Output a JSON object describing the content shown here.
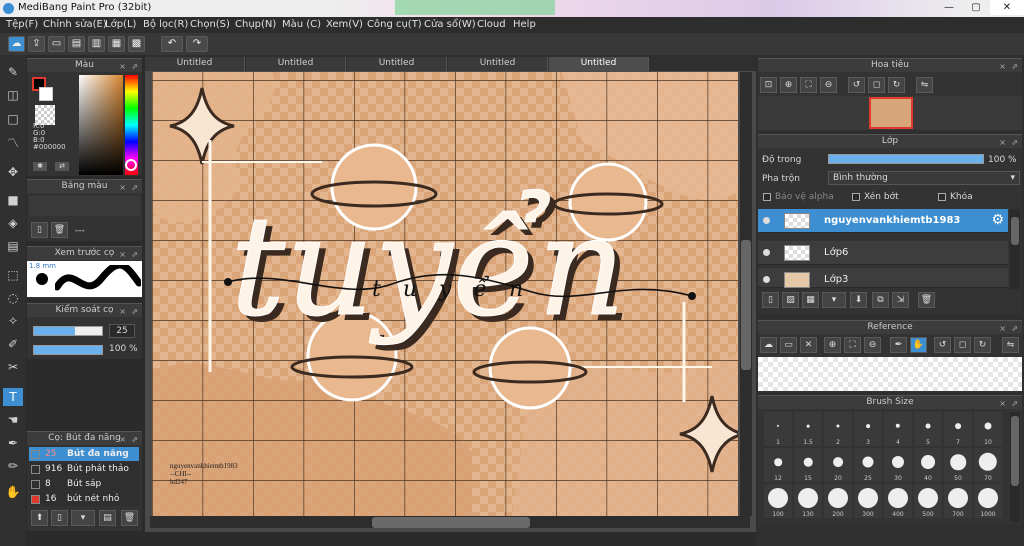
{
  "window": {
    "title": "MediBang Paint Pro (32bit)",
    "controls": [
      "—",
      "▢",
      "✕"
    ]
  },
  "menu": [
    "Tệp(F)",
    "Chỉnh sửa(E)",
    "Lớp(L)",
    "Bộ lọc(R)",
    "Chọn(S)",
    "Chụp(N)",
    "Màu (C)",
    "Xem(V)",
    "Công cụ(T)",
    "Cửa sổ(W)",
    "Cloud",
    "Help"
  ],
  "tabs": [
    "Untitled",
    "Untitled",
    "Untitled",
    "Untitled",
    "Untitled"
  ],
  "active_tab": 4,
  "color_panel": {
    "title": "Màu",
    "r": "R:0",
    "g": "G:0",
    "b": "B:0",
    "hex": "#000000",
    "foreground": "#000000",
    "background": "#ffffff"
  },
  "palette_panel": {
    "title": "Bảng màu",
    "value": "---"
  },
  "preview_panel": {
    "title": "Xem trước cọ",
    "size": "1.8 mm"
  },
  "brush_control": {
    "title": "Kiểm soát cọ",
    "size": "25",
    "opacity": "100 %",
    "size_level": 0.6,
    "opacity_level": 1.0
  },
  "brush_list": {
    "title": "Cọ: Bút đa năng",
    "items": [
      {
        "size": "25",
        "name": "Bút đa năng",
        "color": "#3d8fd1",
        "selected": true
      },
      {
        "size": "916",
        "name": "Bút phát thảo",
        "color": "#2f2f2f",
        "selected": false
      },
      {
        "size": "8",
        "name": "Bút sáp",
        "color": "#2f2f2f",
        "selected": false
      },
      {
        "size": "16",
        "name": "bút nét nhỏ",
        "color": "#e03a2e",
        "selected": false
      }
    ]
  },
  "canvas": {
    "title_text": "tuyển",
    "script_text": "tuyển",
    "signature_lines": [
      "nguyenvankhiemtb1983",
      "--CHI--",
      "hd247"
    ]
  },
  "navigator": {
    "title": "Hoa tiêu"
  },
  "layers": {
    "title": "Lớp",
    "opacity_label": "Độ trong",
    "opacity_value": "100 %",
    "opacity_level": 1.0,
    "blend_label": "Pha trộn",
    "blend_value": "Bình thường",
    "protect_alpha": "Bảo vệ alpha",
    "clipping": "Xén bớt",
    "lock": "Khóa",
    "items": [
      {
        "name": "nguyenvankhiemtb1983",
        "selected": true
      },
      {
        "name": "Lớp6",
        "selected": false
      },
      {
        "name": "Lớp3",
        "selected": false
      }
    ]
  },
  "reference": {
    "title": "Reference"
  },
  "brush_size": {
    "title": "Brush Size",
    "sizes": [
      "1",
      "1.5",
      "2",
      "3",
      "4",
      "5",
      "7",
      "10",
      "12",
      "15",
      "20",
      "25",
      "30",
      "40",
      "50",
      "70",
      "100",
      "130",
      "200",
      "300",
      "400",
      "500",
      "700",
      "1000"
    ]
  }
}
